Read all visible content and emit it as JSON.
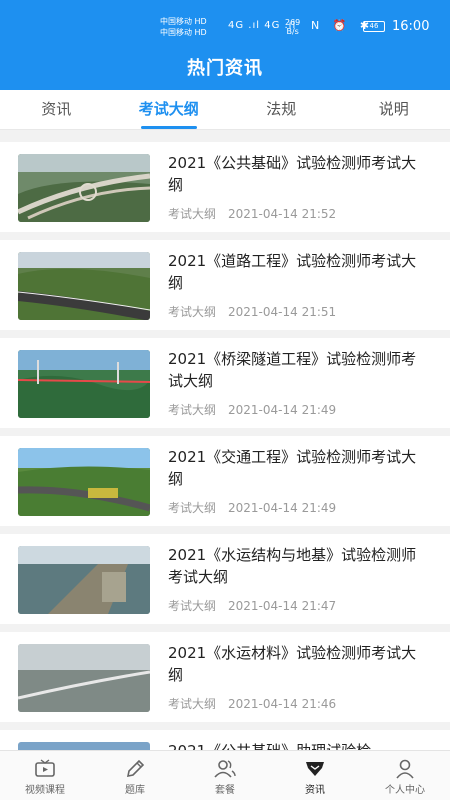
{
  "status_bar": {
    "carrier1": "中国移动 HD",
    "carrier2": "中国移动 HD",
    "signal": "4G .ıl 4G .ıl",
    "speed_value": "269",
    "speed_unit": "B/s",
    "icons": "N ⏰ ✱",
    "battery": "46",
    "time": "16:00"
  },
  "header": {
    "title": "热门资讯"
  },
  "tabs": [
    {
      "label": "资讯"
    },
    {
      "label": "考试大纲"
    },
    {
      "label": "法规"
    },
    {
      "label": "说明"
    }
  ],
  "articles": [
    {
      "title": "2021《公共基础》试验检测师考试大纲",
      "category": "考试大纲",
      "date": "2021-04-14 21:52"
    },
    {
      "title": "2021《道路工程》试验检测师考试大纲",
      "category": "考试大纲",
      "date": "2021-04-14 21:51"
    },
    {
      "title": "2021《桥梁隧道工程》试验检测师考试大纲",
      "category": "考试大纲",
      "date": "2021-04-14 21:49"
    },
    {
      "title": "2021《交通工程》试验检测师考试大纲",
      "category": "考试大纲",
      "date": "2021-04-14 21:49"
    },
    {
      "title": "2021《水运结构与地基》试验检测师考试大纲",
      "category": "考试大纲",
      "date": "2021-04-14 21:47"
    },
    {
      "title": "2021《水运材料》试验检测师考试大纲",
      "category": "考试大纲",
      "date": "2021-04-14 21:46"
    },
    {
      "title": "2021《公共基础》助理试验检",
      "category": "",
      "date": ""
    }
  ],
  "bottom_nav": [
    {
      "label": "视频课程",
      "icon": "video-icon"
    },
    {
      "label": "题库",
      "icon": "pencil-icon"
    },
    {
      "label": "套餐",
      "icon": "users-icon"
    },
    {
      "label": "资讯",
      "icon": "news-icon"
    },
    {
      "label": "个人中心",
      "icon": "person-icon"
    }
  ]
}
